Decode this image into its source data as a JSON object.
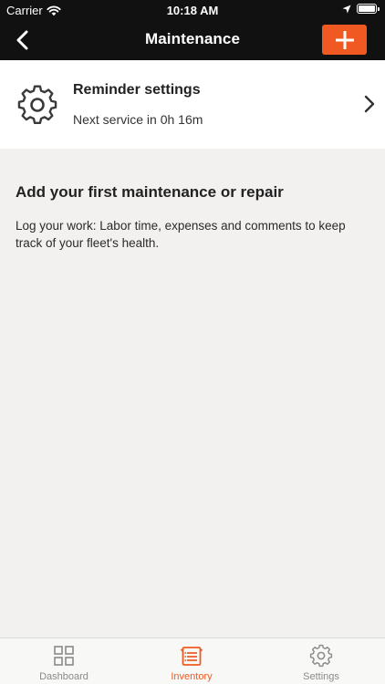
{
  "status_bar": {
    "carrier": "Carrier",
    "time": "10:18 AM"
  },
  "nav": {
    "title": "Maintenance",
    "back_icon": "chevron-left-icon",
    "add_icon": "plus-icon"
  },
  "reminder": {
    "title": "Reminder settings",
    "subtitle": "Next service in 0h 16m",
    "icon": "gear-icon"
  },
  "empty_state": {
    "title": "Add your first maintenance or repair",
    "body": "Log your work: Labor time, expenses and comments to keep track of your fleet's health."
  },
  "tabs": [
    {
      "label": "Dashboard",
      "icon": "grid-icon",
      "active": false
    },
    {
      "label": "Inventory",
      "icon": "inventory-icon",
      "active": true
    },
    {
      "label": "Settings",
      "icon": "gear-icon",
      "active": false
    }
  ],
  "colors": {
    "accent": "#f05a22",
    "header_bg": "#111111",
    "background": "#f2f1ef",
    "inactive_tab": "#8a8a8a"
  }
}
